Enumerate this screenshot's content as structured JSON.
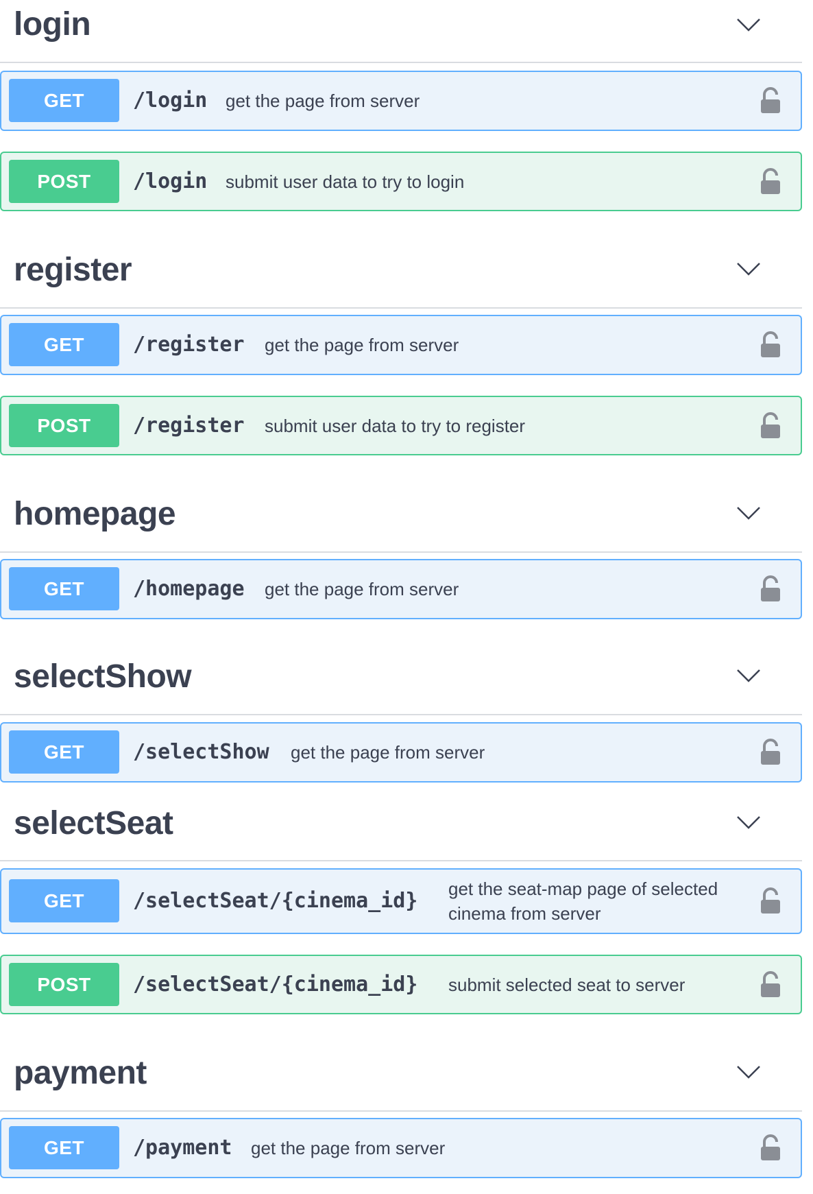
{
  "colors": {
    "get_accent": "#61affe",
    "get_background": "#ebf3fb",
    "post_accent": "#49cc90",
    "post_background": "#e8f6f0",
    "text": "#3b4151",
    "lock_icon": "#8a8e95"
  },
  "icons": {
    "expand": "chevron-down-icon",
    "auth": "lock-icon"
  },
  "tags": [
    {
      "name": "login",
      "operations": [
        {
          "method": "GET",
          "path": "/login",
          "summary": "get the page from server"
        },
        {
          "method": "POST",
          "path": "/login",
          "summary": "submit user data to try to login"
        }
      ]
    },
    {
      "name": "register",
      "operations": [
        {
          "method": "GET",
          "path": "/register",
          "summary": "get the page from server"
        },
        {
          "method": "POST",
          "path": "/register",
          "summary": "submit user data to try to register"
        }
      ]
    },
    {
      "name": "homepage",
      "operations": [
        {
          "method": "GET",
          "path": "/homepage",
          "summary": "get the page from server"
        }
      ]
    },
    {
      "name": "selectShow",
      "operations": [
        {
          "method": "GET",
          "path": "/selectShow",
          "summary": "get the page from server"
        }
      ]
    },
    {
      "name": "selectSeat",
      "operations": [
        {
          "method": "GET",
          "path": "/selectSeat/{cinema_id}",
          "summary": "get the seat-map page of selected cinema from server"
        },
        {
          "method": "POST",
          "path": "/selectSeat/{cinema_id}",
          "summary": "submit selected seat to server"
        }
      ]
    },
    {
      "name": "payment",
      "operations": [
        {
          "method": "GET",
          "path": "/payment",
          "summary": "get the page from server"
        }
      ]
    }
  ]
}
